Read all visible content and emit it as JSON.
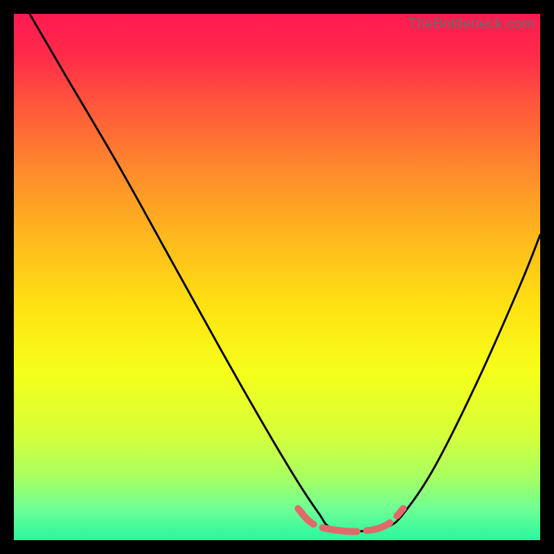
{
  "watermark": "TheBottleneck.com",
  "gradient": {
    "stops": [
      {
        "offset": 0.0,
        "color": "#ff1a52"
      },
      {
        "offset": 0.08,
        "color": "#ff2b4a"
      },
      {
        "offset": 0.18,
        "color": "#ff5a3a"
      },
      {
        "offset": 0.3,
        "color": "#ff8b2c"
      },
      {
        "offset": 0.42,
        "color": "#ffb71e"
      },
      {
        "offset": 0.55,
        "color": "#ffe012"
      },
      {
        "offset": 0.68,
        "color": "#f6ff1a"
      },
      {
        "offset": 0.8,
        "color": "#d6ff3a"
      },
      {
        "offset": 0.88,
        "color": "#a8ff62"
      },
      {
        "offset": 0.94,
        "color": "#6fff95"
      },
      {
        "offset": 1.0,
        "color": "#28f7a0"
      }
    ]
  },
  "dash": {
    "color": "#e06a6a",
    "width": 10,
    "pattern": "32 14 50 14 36 14 36 500"
  },
  "chart_data": {
    "type": "line",
    "title": "",
    "xlabel": "",
    "ylabel": "",
    "xlim": [
      0,
      100
    ],
    "ylim": [
      0,
      100
    ],
    "note": "Axes are unlabeled in the source image; x/y values below are normalized 0–100 to the visible plot area (y=0 at bottom, y=100 at top). Curve forms a V shape with a flat minimum segment near x≈59–70.",
    "series": [
      {
        "name": "curve",
        "x": [
          3,
          10,
          20,
          30,
          40,
          48,
          54,
          58,
          60,
          64,
          68,
          71,
          74,
          80,
          88,
          96,
          100
        ],
        "y": [
          100,
          88,
          71,
          53,
          35,
          21,
          11,
          5,
          2.5,
          1.8,
          1.8,
          2.5,
          5,
          14,
          30,
          48,
          58
        ]
      },
      {
        "name": "min-marker-dashes",
        "x": [
          54,
          57,
          62,
          67,
          71,
          74
        ],
        "y": [
          6,
          3,
          1.8,
          1.8,
          3,
          6
        ]
      }
    ]
  }
}
